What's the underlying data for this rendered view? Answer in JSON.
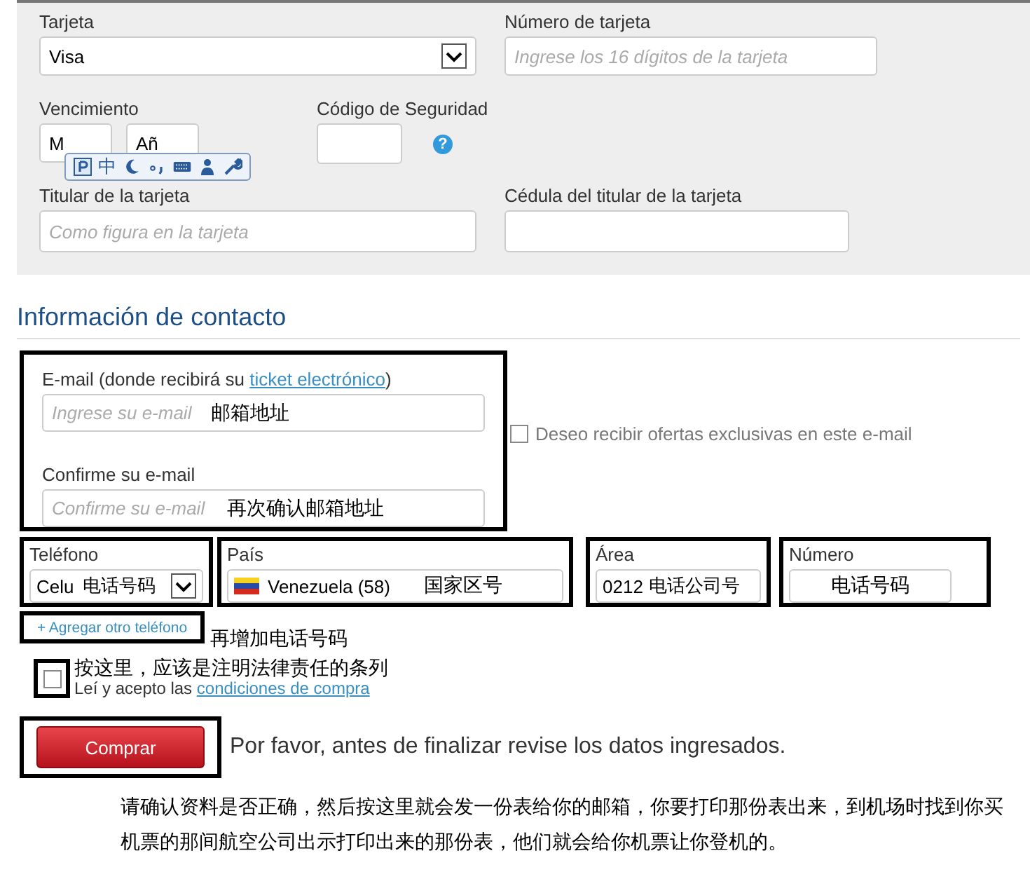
{
  "payment": {
    "card_type": {
      "label": "Tarjeta",
      "value": "Visa"
    },
    "card_number": {
      "label": "Número de tarjeta",
      "placeholder": "Ingrese los 16 dígitos de la tarjeta"
    },
    "expiry": {
      "label": "Vencimiento",
      "month": "M",
      "year": "Añ"
    },
    "security_code": {
      "label": "Código de Seguridad",
      "help": "?"
    },
    "holder": {
      "label": "Titular de la tarjeta",
      "placeholder": "Como figura en la tarjeta"
    },
    "holder_id": {
      "label": "Cédula del titular de la tarjeta"
    }
  },
  "ime_toolbar": {
    "mode": "中"
  },
  "contact": {
    "heading": "Información de contacto",
    "email": {
      "label": "E-mail (donde recibirá su ",
      "link": "ticket electrónico",
      "label_end": ")",
      "placeholder": "Ingrese su e-mail",
      "note": "邮箱地址"
    },
    "confirm": {
      "label": "Confirme su e-mail",
      "placeholder": "Confirme su e-mail",
      "note": "再次确认邮箱地址"
    },
    "offers": {
      "label": "Deseo recibir ofertas exclusivas en este e-mail",
      "checked": false
    },
    "phone": {
      "type": {
        "label": "Teléfono",
        "value": "Celu",
        "note": "电话号码"
      },
      "country": {
        "label": "País",
        "value": "Venezuela (58)",
        "note": "国家区号"
      },
      "area": {
        "label": "Área",
        "value": "0212",
        "note": "电话公司号"
      },
      "number": {
        "label": "Número",
        "note": "电话号码"
      }
    },
    "add_phone": {
      "label": "+ Agregar otro teléfono",
      "note": "再增加电话号码"
    }
  },
  "terms": {
    "label": "Leí y acepto las",
    "link": "condiciones de compra",
    "checked": false,
    "note": "按这里，应该是注明法律责任的条列"
  },
  "purchase": {
    "button": "Comprar",
    "message": "Por favor, antes de finalizar revise los datos ingresados.",
    "note": "请确认资料是否正确，然后按这里就会发一份表给你的邮箱，你要打印那份表出来，到机场时找到你买机票的那间航空公司出示打印出来的那份表，他们就会给你机票让你登机的。"
  }
}
